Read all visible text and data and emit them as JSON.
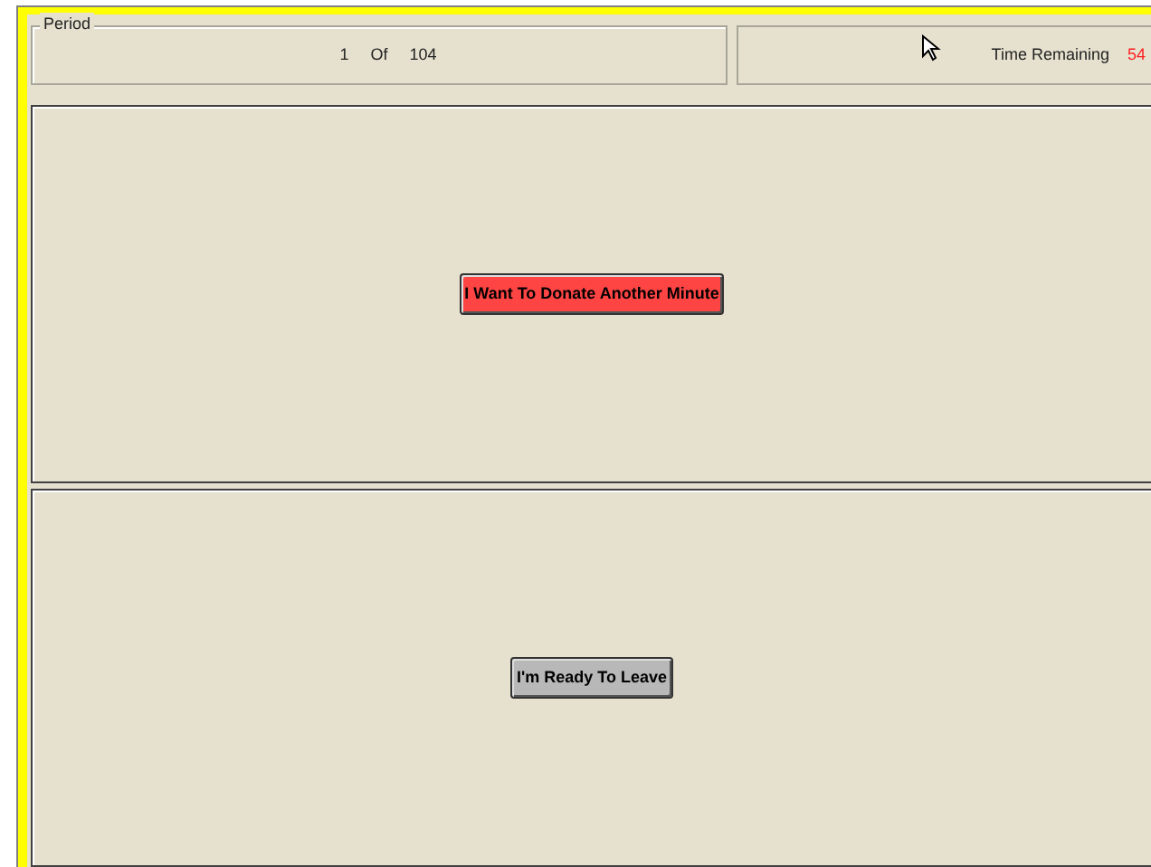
{
  "period_panel": {
    "legend": "Period",
    "current": "1",
    "of": "Of",
    "total": "104"
  },
  "timer_panel": {
    "label": "Time Remaining",
    "value": "54"
  },
  "sections": [
    {
      "button": {
        "label": "I Want To Donate Another Minute",
        "kind": "alert"
      }
    },
    {
      "button": {
        "label": "I'm Ready To Leave",
        "kind": "normal"
      }
    }
  ]
}
